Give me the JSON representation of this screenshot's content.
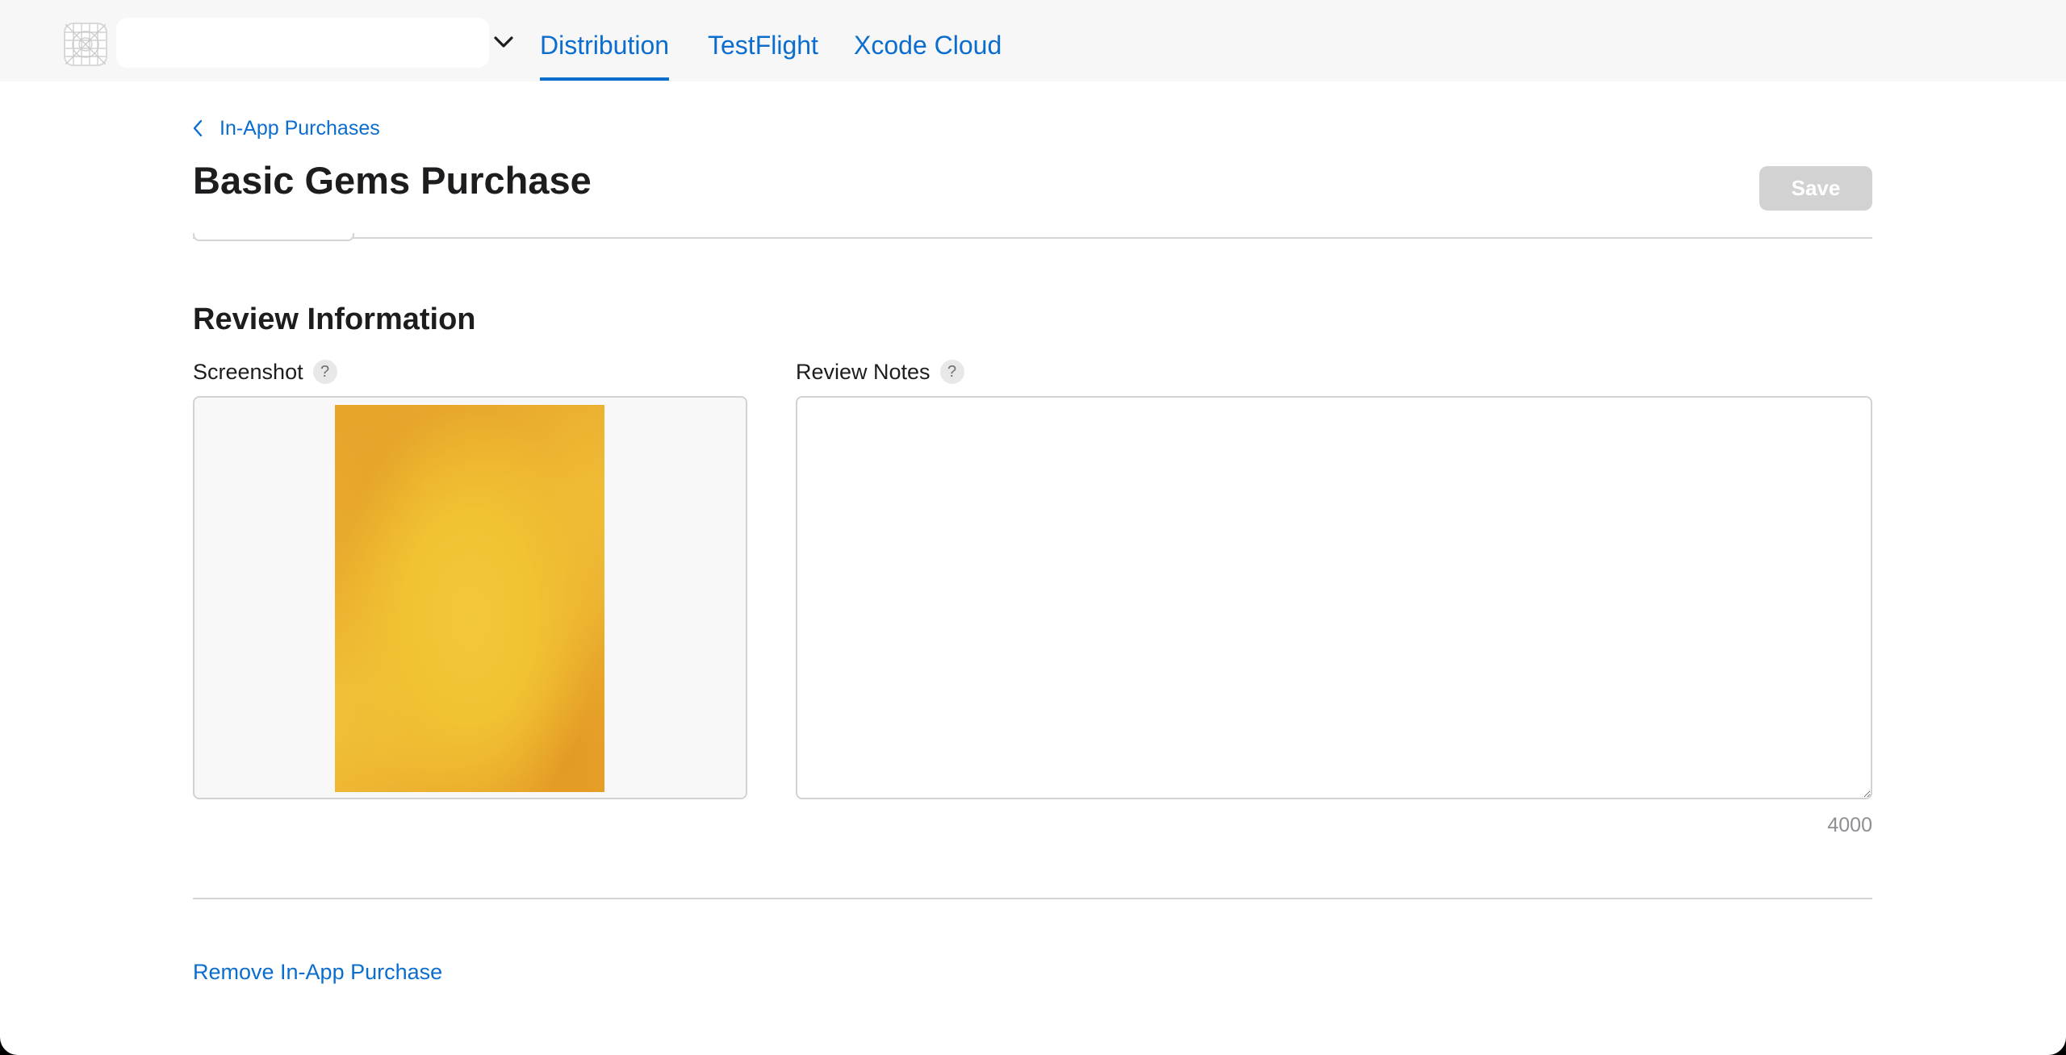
{
  "header": {
    "app_name": "",
    "tabs": [
      {
        "label": "Distribution",
        "active": true
      },
      {
        "label": "TestFlight",
        "active": false
      },
      {
        "label": "Xcode Cloud",
        "active": false
      }
    ]
  },
  "breadcrumb": {
    "label": "In-App Purchases"
  },
  "page": {
    "title": "Basic Gems Purchase",
    "save_label": "Save"
  },
  "review": {
    "title": "Review Information",
    "screenshot_label": "Screenshot",
    "notes_label": "Review Notes",
    "help_glyph": "?",
    "notes_value": "",
    "char_limit": "4000"
  },
  "footer": {
    "remove_label": "Remove In-App Purchase"
  },
  "colors": {
    "accent": "#0b6dce",
    "save_disabled": "#d2d2d2",
    "screenshot_fill": "#f1c232"
  },
  "icons": [
    "app-icon-placeholder",
    "chevron-down-icon",
    "chevron-left-icon",
    "help-icon"
  ]
}
